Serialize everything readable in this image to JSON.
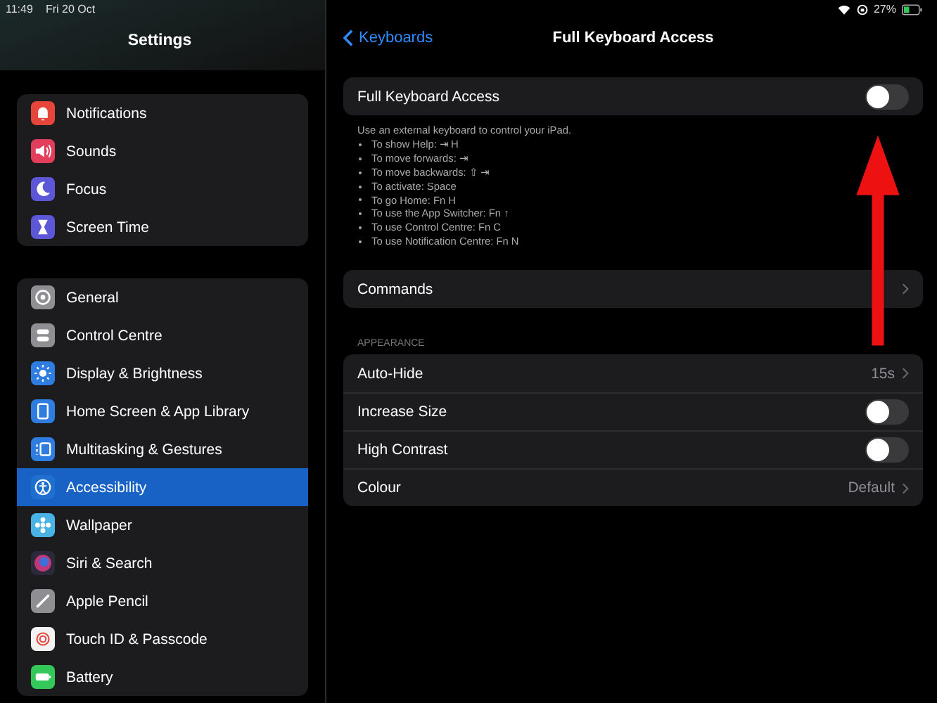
{
  "status_bar": {
    "time": "11:49",
    "date": "Fri 20 Oct",
    "battery": "27%"
  },
  "sidebar": {
    "title": "Settings",
    "groups": [
      [
        {
          "label": "Notifications",
          "kind": "bell",
          "color": "#e5453a",
          "selected": false
        },
        {
          "label": "Sounds",
          "kind": "speaker",
          "color": "#e33d5c",
          "selected": false
        },
        {
          "label": "Focus",
          "kind": "moon",
          "color": "#5b57d6",
          "selected": false
        },
        {
          "label": "Screen Time",
          "kind": "hourglass",
          "color": "#5b57d6",
          "selected": false
        }
      ],
      [
        {
          "label": "General",
          "kind": "gear",
          "color": "#8e8e93",
          "selected": false
        },
        {
          "label": "Control Centre",
          "kind": "switches",
          "color": "#8e8e93",
          "selected": false
        },
        {
          "label": "Display & Brightness",
          "kind": "sun",
          "color": "#2f7de1",
          "selected": false
        },
        {
          "label": "Home Screen & App Library",
          "kind": "grid",
          "color": "#2f7de1",
          "selected": false
        },
        {
          "label": "Multitasking & Gestures",
          "kind": "windows",
          "color": "#2f7de1",
          "selected": false
        },
        {
          "label": "Accessibility",
          "kind": "person",
          "color": "#1f6fd0",
          "selected": true
        },
        {
          "label": "Wallpaper",
          "kind": "flower",
          "color": "#4ab3e6",
          "selected": false
        },
        {
          "label": "Siri & Search",
          "kind": "orb",
          "color": "#2a2a3a",
          "selected": false
        },
        {
          "label": "Apple Pencil",
          "kind": "pencil",
          "color": "#8e8e93",
          "selected": false
        },
        {
          "label": "Touch ID & Passcode",
          "kind": "fingerprint",
          "color": "#f2f2f2",
          "selected": false
        },
        {
          "label": "Battery",
          "kind": "battery",
          "color": "#34c759",
          "selected": false
        }
      ]
    ]
  },
  "detail": {
    "back": "Keyboards",
    "title": "Full Keyboard Access",
    "main_toggle": {
      "label": "Full Keyboard Access",
      "on": false
    },
    "description": "Use an external keyboard to control your iPad.",
    "shortcuts": [
      "To show Help: ⇥ H",
      "To move forwards: ⇥",
      "To move backwards: ⇧ ⇥",
      "To activate: Space",
      "To go Home: Fn H",
      "To use the App Switcher: Fn ↑",
      "To use Control Centre: Fn C",
      "To use Notification Centre: Fn N"
    ],
    "commands": "Commands",
    "appearance_header": "APPEARANCE",
    "appearance": [
      {
        "kind": "link",
        "label": "Auto-Hide",
        "value": "15s"
      },
      {
        "kind": "toggle",
        "label": "Increase Size",
        "on": false
      },
      {
        "kind": "toggle",
        "label": "High Contrast",
        "on": false
      },
      {
        "kind": "link",
        "label": "Colour",
        "value": "Default"
      }
    ]
  }
}
